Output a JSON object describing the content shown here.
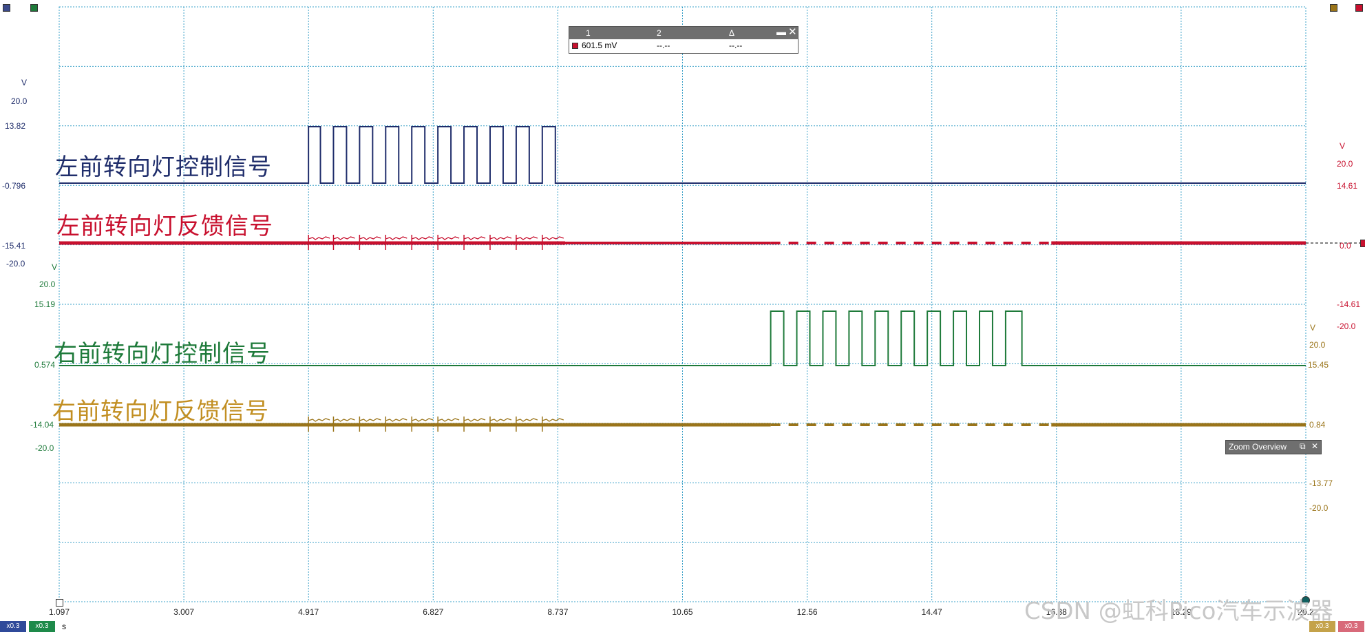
{
  "chart_data": {
    "type": "line",
    "x_unit": "s",
    "x_ticks": [
      "1.097",
      "3.007",
      "4.917",
      "6.827",
      "8.737",
      "10.65",
      "12.56",
      "14.47",
      "16.38",
      "18.29",
      "20.2"
    ],
    "xlim": [
      1.097,
      20.2
    ],
    "series": [
      {
        "name": "左前转向灯控制信号",
        "color": "#1f2d6b",
        "unit": "V",
        "axis_side": "left",
        "axis_labels": [
          "V",
          "20.0",
          "13.82",
          "-0.796",
          "-15.41",
          "-20.0"
        ],
        "low": -0.796,
        "high": 13.82,
        "pulses": [
          [
            4.917,
            5.1
          ],
          [
            5.3,
            5.5
          ],
          [
            5.7,
            5.9
          ],
          [
            6.1,
            6.3
          ],
          [
            6.5,
            6.7
          ],
          [
            6.9,
            7.1
          ],
          [
            7.3,
            7.5
          ],
          [
            7.7,
            7.9
          ],
          [
            8.1,
            8.3
          ],
          [
            8.5,
            8.7
          ]
        ]
      },
      {
        "name": "左前转向灯反馈信号",
        "color": "#c8102e",
        "unit": "V",
        "axis_side": "right",
        "axis_labels": [
          "V",
          "20.0",
          "14.61",
          "0.0",
          "-14.61",
          "-20.0"
        ],
        "baseline": 0.0,
        "active_range": [
          4.917,
          8.85
        ],
        "dashed_range": [
          12.0,
          16.3
        ]
      },
      {
        "name": "右前转向灯控制信号",
        "color": "#1e7a3a",
        "unit": "V",
        "axis_side": "left",
        "axis_labels": [
          "V",
          "20.0",
          "15.19",
          "0.574",
          "-14.04",
          "-20.0"
        ],
        "low": 0.574,
        "high": 15.19,
        "pulses": [
          [
            12.0,
            12.2
          ],
          [
            12.4,
            12.6
          ],
          [
            12.8,
            13.0
          ],
          [
            13.2,
            13.4
          ],
          [
            13.6,
            13.8
          ],
          [
            14.0,
            14.2
          ],
          [
            14.4,
            14.6
          ],
          [
            14.8,
            15.0
          ],
          [
            15.2,
            15.4
          ],
          [
            15.6,
            15.85
          ]
        ]
      },
      {
        "name": "右前转向灯反馈信号",
        "color": "#9a7419",
        "unit": "V",
        "axis_side": "right",
        "axis_labels": [
          "V",
          "20.0",
          "15.45",
          "0.84",
          "-13.77",
          "-20.0"
        ],
        "baseline": 0.84,
        "active_range": [
          4.917,
          8.85
        ],
        "dashed_range": [
          12.0,
          16.3
        ]
      }
    ],
    "grid": true
  },
  "measurement": {
    "col1": "1",
    "col2": "2",
    "col3": "Δ",
    "value1": "601.5 mV",
    "value2": "--.--",
    "value3": "--.--"
  },
  "zoom_overview": {
    "label": "Zoom Overview"
  },
  "footer": {
    "scale_blue": "x0.3",
    "scale_green": "x0.3",
    "unit": "s",
    "scale_gold": "x0.3",
    "scale_red": "x0.3"
  },
  "watermark": "CSDN @虹科Pico汽车示波器",
  "colors": {
    "grid": "#3aa0c8",
    "blue": "#1f2d6b",
    "red": "#c8102e",
    "green": "#1e7a3a",
    "gold": "#9a7419"
  }
}
